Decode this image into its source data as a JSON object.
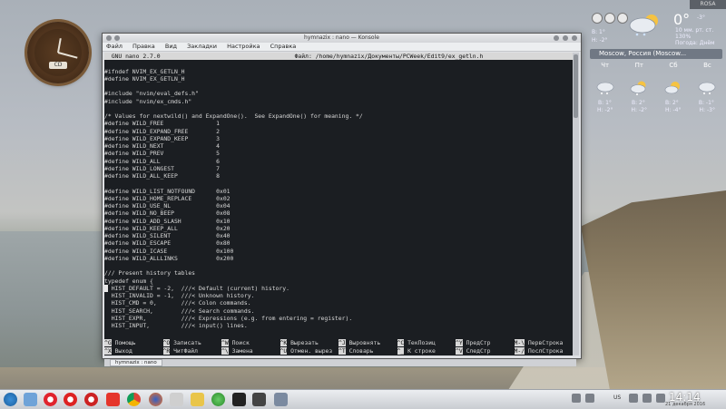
{
  "desktop": {
    "corner_label": "ROSA"
  },
  "clock": {
    "badge": "CD"
  },
  "weather": {
    "temp": "0°",
    "temp_small": "-3°",
    "today_hi": "В: 1°",
    "today_lo": "Н: -2°",
    "line1": "10 мм. рт. ст.",
    "line2": "130%",
    "line3": "Погода: Днём",
    "location": "Moscow, Россия (Moscow...",
    "days": [
      "Чт",
      "Пт",
      "Сб",
      "Вс"
    ],
    "highs": [
      "В: 1°",
      "В: 2°",
      "В: 2°",
      "В: -1°"
    ],
    "lows": [
      "Н: -2°",
      "Н: -2°",
      "Н: -4°",
      "Н: -3°"
    ]
  },
  "window": {
    "title": "hymnazix : nano — Konsole",
    "menu": [
      "Файл",
      "Правка",
      "Вид",
      "Закладки",
      "Настройка",
      "Справка"
    ],
    "tab_label": "hymnazix : nano"
  },
  "nano": {
    "header_left": "  GNU nano 2.7.0",
    "header_file": "Файл: /home/hymnazix/Документы/PCWeek/Edit9/ex_getln.h",
    "lines": [
      "",
      "#ifndef NVIM_EX_GETLN_H",
      "#define NVIM_EX_GETLN_H",
      "",
      "#include \"nvim/eval_defs.h\"",
      "#include \"nvim/ex_cmds.h\"",
      "",
      "/* Values for nextwild() and ExpandOne().  See ExpandOne() for meaning. */",
      "#define WILD_FREE               1",
      "#define WILD_EXPAND_FREE        2",
      "#define WILD_EXPAND_KEEP        3",
      "#define WILD_NEXT               4",
      "#define WILD_PREV               5",
      "#define WILD_ALL                6",
      "#define WILD_LONGEST            7",
      "#define WILD_ALL_KEEP           8",
      "",
      "#define WILD_LIST_NOTFOUND      0x01",
      "#define WILD_HOME_REPLACE       0x02",
      "#define WILD_USE_NL             0x04",
      "#define WILD_NO_BEEP            0x08",
      "#define WILD_ADD_SLASH          0x10",
      "#define WILD_KEEP_ALL           0x20",
      "#define WILD_SILENT             0x40",
      "#define WILD_ESCAPE             0x80",
      "#define WILD_ICASE              0x100",
      "#define WILD_ALLLINKS           0x200",
      "",
      "/// Present history tables",
      "typedef enum {",
      "  HIST_DEFAULT = -2,  ///< Default (current) history.",
      "  HIST_INVALID = -1,  ///< Unknown history.",
      "  HIST_CMD = 0,       ///< Colon commands.",
      "  HIST_SEARCH,        ///< Search commands.",
      "  HIST_EXPR,          ///< Expressions (e.g. from entering = register).",
      "  HIST_INPUT,         ///< input() lines."
    ],
    "shortcuts_row1": [
      {
        "key": "^G",
        "label": "Помощь"
      },
      {
        "key": "^O",
        "label": "Записать"
      },
      {
        "key": "^W",
        "label": "Поиск"
      },
      {
        "key": "^K",
        "label": "Вырезать"
      },
      {
        "key": "^J",
        "label": "Выровнять"
      },
      {
        "key": "^C",
        "label": "ТекПозиц"
      },
      {
        "key": "^Y",
        "label": "ПредСтр"
      },
      {
        "key": "M-\\",
        "label": "ПервСтрока"
      }
    ],
    "shortcuts_row2": [
      {
        "key": "^X",
        "label": "Выход"
      },
      {
        "key": "^R",
        "label": "ЧитФайл"
      },
      {
        "key": "^\\",
        "label": "Замена"
      },
      {
        "key": "^U",
        "label": "Отмен. вырез"
      },
      {
        "key": "^T",
        "label": "Словарь"
      },
      {
        "key": "^_",
        "label": "К строке"
      },
      {
        "key": "^V",
        "label": "СледСтр"
      },
      {
        "key": "M-/",
        "label": "ПослСтрока"
      }
    ]
  },
  "taskbar": {
    "lang": "US",
    "time": "14:14",
    "date": "21 декабря 2016"
  }
}
